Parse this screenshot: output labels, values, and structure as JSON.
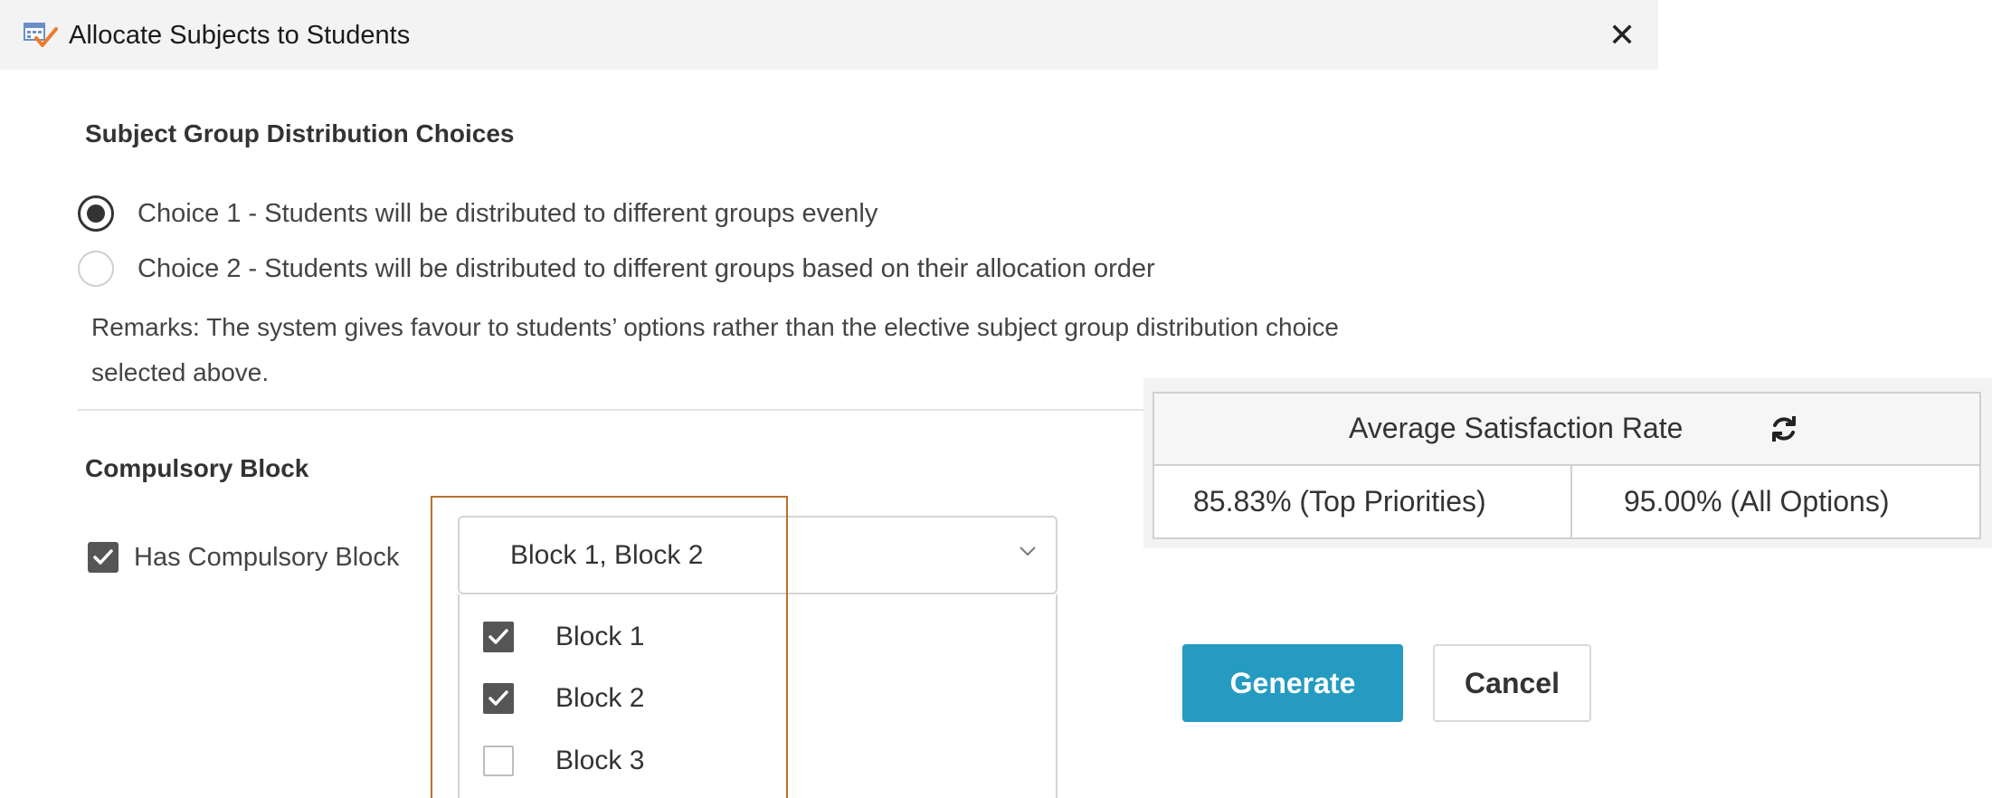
{
  "window": {
    "title": "Allocate Subjects to Students",
    "close_glyph": "✕",
    "app_icon": "calendar-check-icon"
  },
  "distribution": {
    "heading": "Subject Group Distribution Choices",
    "choices": [
      {
        "label": "Choice 1 - Students will be distributed to different groups evenly",
        "selected": true
      },
      {
        "label": "Choice 2 - Students will be distributed to different groups based on their allocation order",
        "selected": false
      }
    ],
    "remarks_line1": "Remarks: The system gives favour to students’ options rather than the elective subject group distribution choice",
    "remarks_line2": "selected above."
  },
  "compulsory": {
    "heading": "Compulsory Block",
    "checkbox_label": "Has Compulsory Block",
    "checkbox_checked": true,
    "select_value": "Block 1, Block 2",
    "options": [
      {
        "label": "Block 1",
        "checked": true
      },
      {
        "label": "Block 2",
        "checked": true
      },
      {
        "label": "Block 3",
        "checked": false
      }
    ]
  },
  "satisfaction": {
    "title": "Average Satisfaction Rate",
    "refresh_icon": "refresh-icon",
    "top_priorities": "85.83% (Top Priorities)",
    "all_options": "95.00% (All Options)"
  },
  "actions": {
    "generate_label": "Generate",
    "cancel_label": "Cancel"
  },
  "colors": {
    "primary_button": "#259bc2",
    "highlight_border": "#b8732c",
    "checkbox_fill": "#555555"
  }
}
